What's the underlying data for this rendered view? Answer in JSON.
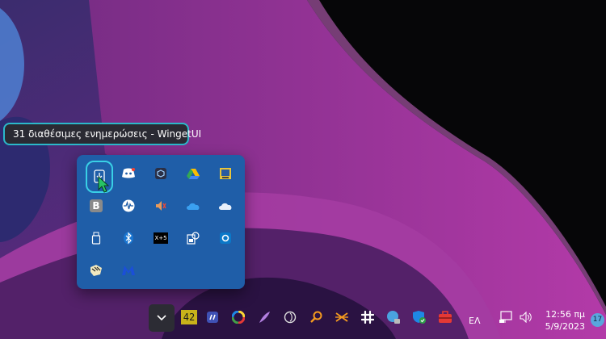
{
  "tooltip": {
    "text": "31 διαθέσιμες ενημερώσεις - WingetUI"
  },
  "tray": {
    "icons": [
      {
        "name": "wingetui-icon"
      },
      {
        "name": "discord-icon"
      },
      {
        "name": "cube-app-icon"
      },
      {
        "name": "google-drive-icon"
      },
      {
        "name": "monitor-app-icon"
      },
      {
        "name": "b-app-icon",
        "label": "B"
      },
      {
        "name": "audio-wave-icon"
      },
      {
        "name": "speaker-icon"
      },
      {
        "name": "onedrive-business-icon"
      },
      {
        "name": "onedrive-icon"
      },
      {
        "name": "usb-drive-icon"
      },
      {
        "name": "bluetooth-icon"
      },
      {
        "name": "xmeters-icon",
        "label": "X+5"
      },
      {
        "name": "system-tool-icon"
      },
      {
        "name": "sync-app-icon"
      },
      {
        "name": "tiger-app-icon"
      },
      {
        "name": "malwarebytes-icon"
      }
    ]
  },
  "taskbar": {
    "counter_label": "42",
    "lang": "ΕΛ",
    "time": "12:56 πμ",
    "date": "5/9/2023",
    "notification_count": "17"
  },
  "colors": {
    "tray_bg": "#1f5ea8",
    "accent": "#39d0e6",
    "wallpaper_purple": "#8e2a8e"
  }
}
